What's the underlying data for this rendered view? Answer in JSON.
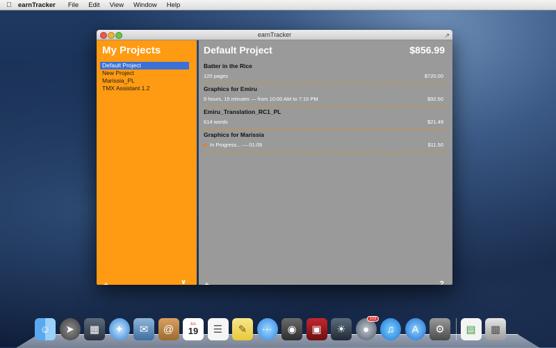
{
  "menubar": {
    "app_name": "earnTracker",
    "menus": [
      "File",
      "Edit",
      "View",
      "Window",
      "Help"
    ]
  },
  "window": {
    "title": "earnTracker"
  },
  "sidebar": {
    "title": "My Projects",
    "projects": [
      {
        "label": "Default Project",
        "selected": true
      },
      {
        "label": "New Project",
        "selected": false
      },
      {
        "label": "Marissia_PL",
        "selected": false
      },
      {
        "label": "TMX Assistant 1.2",
        "selected": false
      }
    ],
    "add_label": "+",
    "remove_label": "—",
    "menu_label": "∨"
  },
  "main": {
    "project_title": "Default Project",
    "total": "$856.99",
    "entries": [
      {
        "name": "Batter in the Rice",
        "detail": "120 pages",
        "amount": "$720.00"
      },
      {
        "name": "Graphics for Emiru",
        "detail": "9 hours, 15 minutes — from 10:00 AM to 7:15 PM",
        "amount": "$92.50"
      },
      {
        "name": "Emiru_Translation_RC1_PL",
        "detail": "614 words",
        "amount": "$21.49"
      },
      {
        "name": "Graphics for Marissia",
        "detail": "In Progress... — 01:09",
        "amount": "$11.50",
        "in_progress": true
      }
    ],
    "add_label": "+",
    "remove_label": "—",
    "help_label": "?"
  },
  "dock": {
    "calendar_month": "JUL",
    "calendar_day": "19",
    "badge": "103",
    "icons": [
      "finder-icon",
      "launchpad-icon",
      "mission-control-icon",
      "safari-icon",
      "mail-icon",
      "contacts-icon",
      "calendar-icon",
      "reminders-icon",
      "notes-icon",
      "messages-icon",
      "facetime-icon",
      "photo-booth-icon",
      "iphoto-icon",
      "app-icon",
      "itunes-icon",
      "app-store-icon",
      "system-preferences-icon",
      "document-icon",
      "trash-icon"
    ]
  }
}
